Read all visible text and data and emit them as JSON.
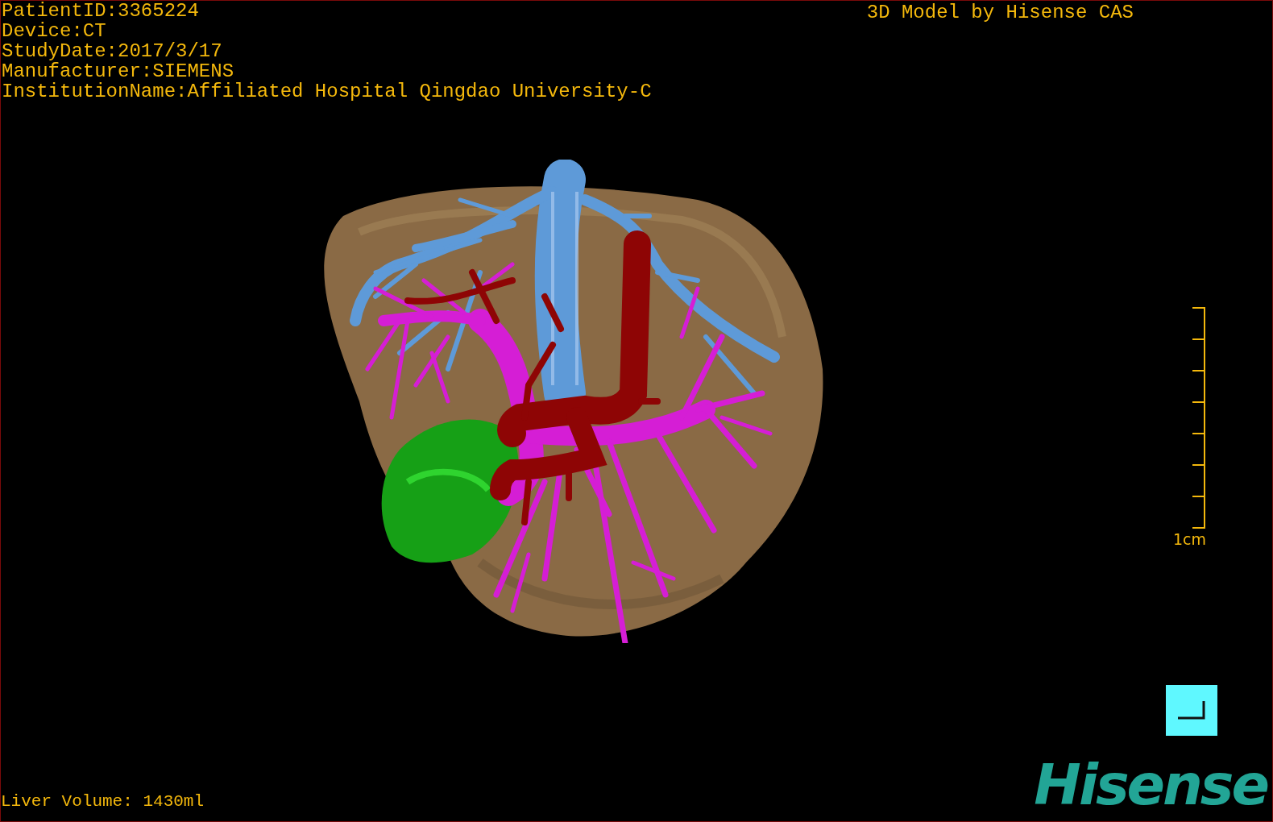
{
  "patient_info": [
    "PatientID:3365224",
    "Device:CT",
    "StudyDate:2017/3/17",
    "Manufacturer:SIEMENS",
    "InstitutionName:Affiliated Hospital Qingdao University-C"
  ],
  "title": "3D Model by Hisense CAS",
  "scale_bar": {
    "label": "1cm"
  },
  "liver_volume": "Liver Volume: 1430ml",
  "logo": "Hisense"
}
